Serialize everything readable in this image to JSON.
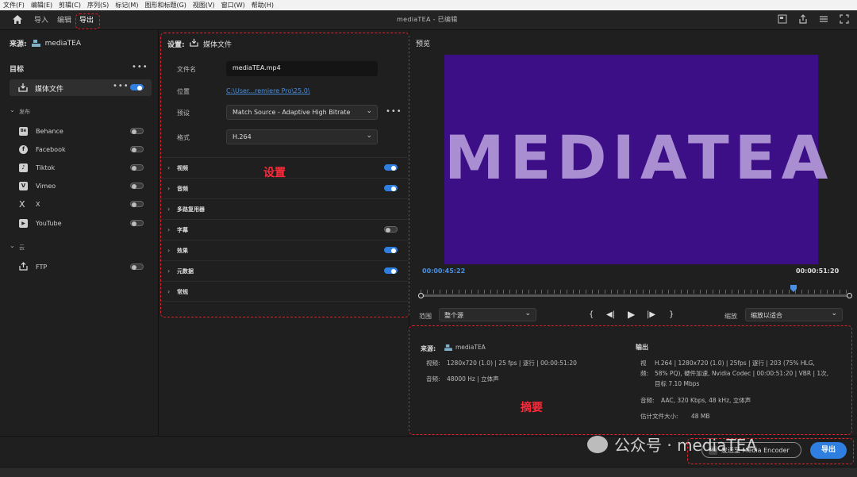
{
  "menu": [
    "文件(F)",
    "编辑(E)",
    "剪辑(C)",
    "序列(S)",
    "标记(M)",
    "图形和标题(G)",
    "视图(V)",
    "窗口(W)",
    "帮助(H)"
  ],
  "header": {
    "tabs": [
      "导入",
      "编辑",
      "导出"
    ],
    "active_tab": "导出",
    "title": "mediaTEA - 已编辑"
  },
  "left": {
    "source_label": "来源:",
    "source_name": "mediaTEA",
    "target_title": "目标",
    "media_file": "媒体文件",
    "media_file_enabled": true,
    "publish_group": "发布",
    "publish_items": [
      {
        "label": "Behance",
        "icon": "Bē",
        "enabled": false
      },
      {
        "label": "Facebook",
        "icon": "f",
        "enabled": false
      },
      {
        "label": "Tiktok",
        "icon": "♪",
        "enabled": false
      },
      {
        "label": "Vimeo",
        "icon": "V",
        "enabled": false
      },
      {
        "label": "X",
        "icon": "X",
        "enabled": false
      },
      {
        "label": "YouTube",
        "icon": "▶",
        "enabled": false
      }
    ],
    "cloud_group": "云",
    "cloud_items": [
      {
        "label": "FTP",
        "enabled": false
      }
    ]
  },
  "settings": {
    "header_label": "设置:",
    "header_target": "媒体文件",
    "filename_label": "文件名",
    "filename_value": "mediaTEA.mp4",
    "location_label": "位置",
    "location_value": "C:\\User...remiere Pro\\25.0\\",
    "preset_label": "预设",
    "preset_value": "Match Source - Adaptive High Bitrate",
    "format_label": "格式",
    "format_value": "H.264",
    "sections": [
      {
        "label": "视频",
        "toggle": true,
        "enabled": true
      },
      {
        "label": "音频",
        "toggle": true,
        "enabled": true
      },
      {
        "label": "多路复用器",
        "toggle": false
      },
      {
        "label": "字幕",
        "toggle": true,
        "enabled": false
      },
      {
        "label": "效果",
        "toggle": true,
        "enabled": true
      },
      {
        "label": "元数据",
        "toggle": true,
        "enabled": true
      },
      {
        "label": "常规",
        "toggle": false
      }
    ]
  },
  "preview": {
    "label": "预览",
    "text": "MEDIATEA",
    "frame_color": "#3c0f86",
    "text_color": "#a98fd2",
    "timecode_current": "00:00:45:22",
    "timecode_end": "00:00:51:20",
    "playhead_fraction": 0.87,
    "range_label": "范围",
    "range_value": "整个源",
    "zoom_label": "缩放",
    "zoom_value": "缩放以适合"
  },
  "summary": {
    "source_label": "来源:",
    "source_name": "mediaTEA",
    "source_video_label": "视频:",
    "source_video": "1280x720 (1.0) | 25 fps | 逐行 | 00:00:51:20",
    "source_audio_label": "音频:",
    "source_audio": "48000 Hz | 立体声",
    "output_title": "输出",
    "output_video_label": "视频:",
    "output_video": "H.264 | 1280x720 (1.0) | 25fps | 逐行 | 203 (75% HLG, 58% PQ), 硬件加速, Nvidia Codec | 00:00:51:20 | VBR | 1次, 目标 7.10 Mbps",
    "output_audio_label": "音频:",
    "output_audio": "AAC, 320 Kbps, 48 kHz, 立体声",
    "est_size_label": "估计文件大小:",
    "est_size": "48 MB"
  },
  "bottom": {
    "encoder_button": "发送至 Media Encoder",
    "export_button": "导出"
  },
  "annotations": {
    "settings": "设置",
    "summary": "摘要"
  },
  "watermark": "公众号 · mediaTEA",
  "colors": {
    "accent": "#2f7fe0",
    "annotation": "#e0202a",
    "link": "#4a90e2"
  }
}
